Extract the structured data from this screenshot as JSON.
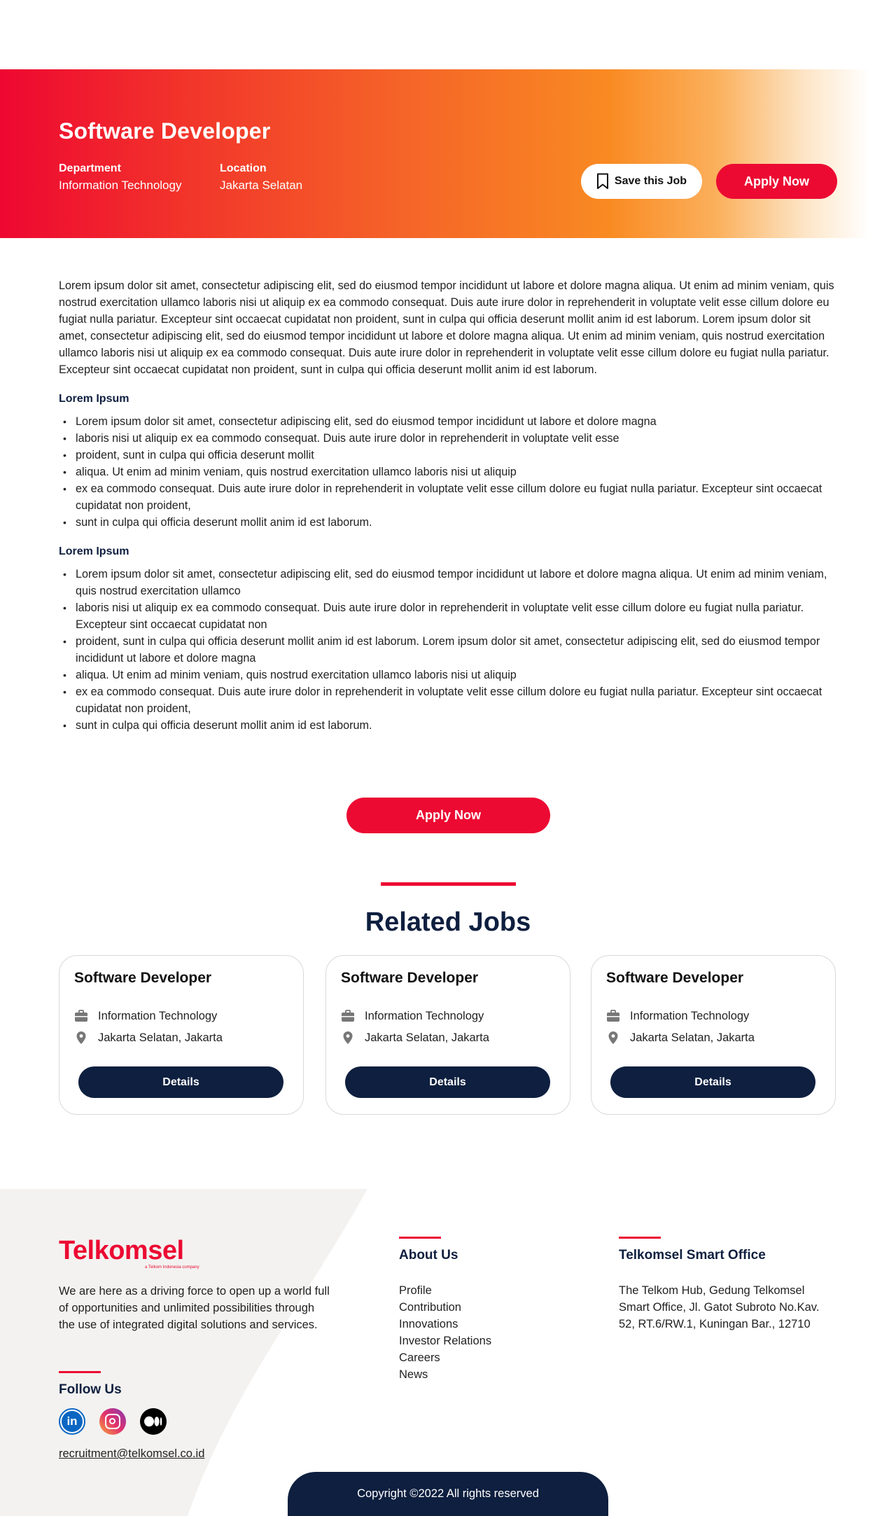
{
  "hero": {
    "title": "Software Developer",
    "department_label": "Department",
    "department_value": "Information Technology",
    "location_label": "Location",
    "location_value": "Jakarta Selatan",
    "save_label": "Save this Job",
    "apply_label": "Apply Now"
  },
  "content": {
    "intro": "Lorem ipsum dolor sit amet, consectetur adipiscing elit, sed do eiusmod tempor incididunt ut labore et dolore magna aliqua. Ut enim ad minim veniam, quis nostrud exercitation ullamco laboris nisi ut aliquip ex ea commodo consequat. Duis aute irure dolor in reprehenderit in voluptate velit esse cillum dolore eu fugiat nulla pariatur. Excepteur sint occaecat cupidatat non proident, sunt in culpa qui officia deserunt mollit anim id est laborum. Lorem ipsum dolor sit amet, consectetur adipiscing elit, sed do eiusmod tempor incididunt ut labore et dolore magna aliqua. Ut enim ad minim veniam, quis nostrud exercitation ullamco laboris nisi ut aliquip ex ea commodo consequat. Duis aute irure dolor in reprehenderit in voluptate velit esse cillum dolore eu fugiat nulla pariatur. Excepteur sint occaecat cupidatat non proident, sunt in culpa qui officia deserunt mollit anim id est laborum.",
    "section1_title": "Lorem Ipsum",
    "section1_items": [
      "Lorem ipsum dolor sit amet, consectetur adipiscing elit, sed do eiusmod tempor incididunt ut labore et dolore magna",
      "laboris nisi ut aliquip ex ea commodo consequat. Duis aute irure dolor in reprehenderit in voluptate velit esse",
      "proident, sunt in culpa qui officia deserunt mollit",
      "aliqua. Ut enim ad minim veniam, quis nostrud exercitation ullamco laboris nisi ut aliquip",
      "ex ea commodo consequat. Duis aute irure dolor in reprehenderit in voluptate velit esse cillum dolore eu fugiat nulla pariatur. Excepteur sint occaecat cupidatat non proident,",
      "sunt in culpa qui officia deserunt mollit anim id est laborum."
    ],
    "section2_title": "Lorem Ipsum",
    "section2_items": [
      "Lorem ipsum dolor sit amet, consectetur adipiscing elit, sed do eiusmod tempor incididunt ut labore et dolore magna aliqua. Ut enim ad minim veniam, quis nostrud exercitation ullamco",
      "laboris nisi ut aliquip ex ea commodo consequat. Duis aute irure dolor in reprehenderit in voluptate velit esse cillum dolore eu fugiat nulla pariatur. Excepteur sint occaecat cupidatat non",
      "proident, sunt in culpa qui officia deserunt mollit anim id est laborum. Lorem ipsum dolor sit amet, consectetur adipiscing elit, sed do eiusmod tempor incididunt ut labore et dolore magna",
      "aliqua. Ut enim ad minim veniam, quis nostrud exercitation ullamco laboris nisi ut aliquip",
      "ex ea commodo consequat. Duis aute irure dolor in reprehenderit in voluptate velit esse cillum dolore eu fugiat nulla pariatur. Excepteur sint occaecat cupidatat non proident,",
      "sunt in culpa qui officia deserunt mollit anim id est laborum."
    ],
    "apply_label": "Apply Now"
  },
  "related": {
    "title": "Related Jobs",
    "cards": [
      {
        "title": "Software Developer",
        "department": "Information Technology",
        "location": "Jakarta Selatan, Jakarta",
        "button": "Details"
      },
      {
        "title": "Software Developer",
        "department": "Information Technology",
        "location": "Jakarta Selatan, Jakarta",
        "button": "Details"
      },
      {
        "title": "Software Developer",
        "department": "Information Technology",
        "location": "Jakarta Selatan, Jakarta",
        "button": "Details"
      }
    ]
  },
  "footer": {
    "logo_text": "Telkomsel",
    "logo_sub": "a Telkom Indonesia company",
    "tagline": "We are here as a driving force to open up a world full of opportunities and unlimited possibilities through the use of integrated digital solutions and services.",
    "follow_title": "Follow Us",
    "social_icons": [
      "linkedin-icon",
      "instagram-icon",
      "medium-icon"
    ],
    "email": "recruitment@telkomsel.co.id",
    "about_title": "About Us",
    "about_links": [
      "Profile",
      "Contribution",
      "Innovations",
      "Investor Relations",
      "Careers",
      "News"
    ],
    "office_title": "Telkomsel Smart Office",
    "office_address": "The Telkom Hub, Gedung Telkomsel Smart Office, Jl. Gatot Subroto No.Kav. 52, RT.6/RW.1, Kuningan Bar., 12710",
    "copyright": "Copyright ©2022 All rights reserved"
  },
  "colors": {
    "brand_red": "#ec0a32",
    "navy": "#0e1f3f",
    "gradient_orange": "#f98a22"
  }
}
